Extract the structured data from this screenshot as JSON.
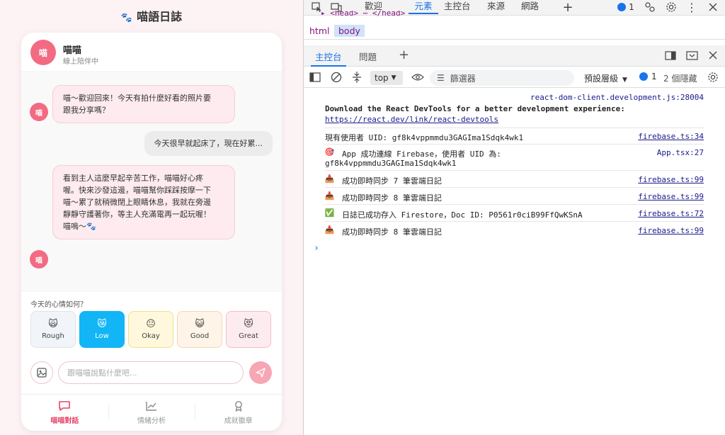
{
  "app": {
    "title": "喵語日誌",
    "title_icon": "paw-icon",
    "chat": {
      "name": "喵喵",
      "status": "線上陪伴中",
      "avatar_text": "喵",
      "messages": [
        {
          "from": "cat",
          "lines": [
            "喵～歡迎回來！今天有拍什麼好看的照片要",
            "跟我分享嗎？"
          ]
        },
        {
          "from": "user",
          "lines": [
            "今天很早就起床了，現在好累..."
          ]
        },
        {
          "from": "cat",
          "lines": [
            "看到主人這麼早起辛苦工作，喵喵好心疼",
            "喔。快來沙發這邊，喵喵幫你踩踩按摩一下",
            "喵～累了就稍微閉上眼睛休息，我就在旁邊",
            "靜靜守護著你，等主人充滿電再一起玩喔！",
            "喵嗚～🐾"
          ]
        }
      ]
    },
    "mood": {
      "question": "今天的心情如何？",
      "options": [
        {
          "label": "Rough",
          "emoji": "🙀",
          "bg": "#f1f5f9",
          "border": "#dde3ea",
          "color": "#444",
          "selected": false
        },
        {
          "label": "Low",
          "emoji": "😿",
          "bg": "#12b5f5",
          "border": "#12b5f5",
          "color": "#ffffff",
          "selected": true
        },
        {
          "label": "Okay",
          "emoji": "😐",
          "bg": "#fff8dc",
          "border": "#f5dd8c",
          "color": "#444",
          "selected": false
        },
        {
          "label": "Good",
          "emoji": "😺",
          "bg": "#fff4e8",
          "border": "#f7d6b2",
          "color": "#444",
          "selected": false
        },
        {
          "label": "Great",
          "emoji": "😻",
          "bg": "#fdecef",
          "border": "#f4bcc7",
          "color": "#444",
          "selected": false
        }
      ]
    },
    "input": {
      "placeholder": "跟喵喵說點什麼吧..."
    },
    "nav": [
      {
        "label": "喵喵對話",
        "icon": "chat-icon",
        "active": true
      },
      {
        "label": "情緒分析",
        "icon": "chart-icon",
        "active": false
      },
      {
        "label": "成就徽章",
        "icon": "badge-icon",
        "active": false
      }
    ],
    "accent": "#f26b82"
  },
  "devtools": {
    "top_tabs": [
      "歡迎",
      "元素",
      "主控台",
      "來源",
      "網路"
    ],
    "active_top_tab": "元素",
    "issues_count": "1",
    "head_snippet": "▸ <head> ⋯ </head>",
    "breadcrumbs": [
      "html",
      "body"
    ],
    "selected_crumb": "body",
    "sub_tabs": [
      "主控台",
      "問題"
    ],
    "active_sub_tab": "主控台",
    "context": "top",
    "filter_placeholder": "篩選器",
    "levels_label": "預設層級",
    "message_count": "1",
    "hidden_label": "2 個隱藏",
    "logs": [
      {
        "source": "react-dom-client.development.js:28004",
        "lines": [
          "Download the React DevTools for a better development experience:",
          "https://react.dev/link/react-devtools"
        ],
        "bold": true
      },
      {
        "icon": "",
        "text": "現有使用者 UID: gf8k4vppmmdu3GAGIma1Sdqk4wk1",
        "source": "firebase.ts:34"
      },
      {
        "icon": "target-icon",
        "emoji": "🎯",
        "lines": [
          "App 成功連線 Firebase，使用者 UID 為:",
          "gf8k4vppmmdu3GAGIma1Sdqk4wk1"
        ],
        "source": "App.tsx:27"
      },
      {
        "icon": "inbox-icon",
        "emoji": "📥",
        "text": "成功即時同步 7 筆雲端日記",
        "source": "firebase.ts:99"
      },
      {
        "icon": "inbox-icon",
        "emoji": "📥",
        "text": "成功即時同步 8 筆雲端日記",
        "source": "firebase.ts:99"
      },
      {
        "icon": "check-icon",
        "emoji": "✅",
        "text": "日誌已成功存入 Firestore，Doc ID: P0561r0ciB99FfQwKSnA",
        "source": "firebase.ts:72"
      },
      {
        "icon": "inbox-icon",
        "emoji": "📥",
        "text": "成功即時同步 8 筆雲端日記",
        "source": "firebase.ts:99"
      }
    ],
    "prompt": "›"
  }
}
